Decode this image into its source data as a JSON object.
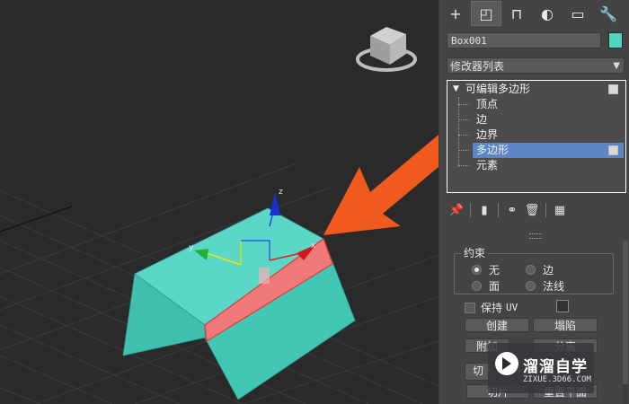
{
  "colors": {
    "object": "#4fd6c2",
    "selected_face": "#f07a7a",
    "arrow": "#f05a1e",
    "selection_blue": "#5b85c4"
  },
  "viewport": {
    "gizmo_labels": {
      "x": "x",
      "y": "y",
      "z": "z"
    },
    "viewcube_icon": "viewcube-icon"
  },
  "panel": {
    "tabs": [
      {
        "icon": "plus-icon",
        "glyph": "+"
      },
      {
        "icon": "modify-icon",
        "glyph": "◰"
      },
      {
        "icon": "hierarchy-icon",
        "glyph": "⊓"
      },
      {
        "icon": "motion-icon",
        "glyph": "◐"
      },
      {
        "icon": "display-icon",
        "glyph": "▭"
      },
      {
        "icon": "utilities-icon",
        "glyph": "🔧"
      }
    ],
    "object_name": "Box001",
    "modifier_list": "修改器列表",
    "stack": {
      "root": "可编辑多边形",
      "items": [
        "顶点",
        "边",
        "边界",
        "多边形",
        "元素"
      ],
      "selected": "多边形"
    },
    "tools": [
      "pin-icon",
      "show-result-icon",
      "make-unique-icon",
      "delete-icon",
      "configure-icon"
    ],
    "constraint": {
      "title": "约束",
      "options": [
        "无",
        "边",
        "面",
        "法线"
      ],
      "selected": "无"
    },
    "preserve_uv": {
      "label": "保持",
      "suffix": "UV"
    },
    "buttons": {
      "create": "创建",
      "collapse": "塌陷",
      "attach": "附加",
      "detach": "分离",
      "slice_plane": "切",
      "reset_plane": "重置平面",
      "slice": "切片"
    }
  },
  "watermark": {
    "title": "溜溜自学",
    "subtitle": "ZIXUE.3D66.COM"
  }
}
